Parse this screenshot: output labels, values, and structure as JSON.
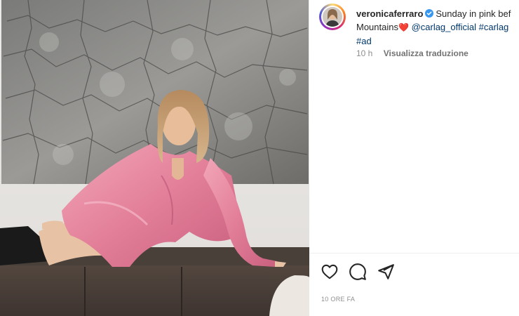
{
  "post": {
    "username": "veronicaferraro",
    "caption_line1": "Sunday in pink bef",
    "caption_line2_text": "Mountains",
    "heart_emoji": "❤️",
    "mention": "@carlag_official",
    "hashtag_1": "#carlag",
    "hashtag_2": "#ad",
    "time_ago_short": "10 h",
    "translate_label": "Visualizza traduzione",
    "time_ago_long": "10 ORE FA"
  },
  "icons": {
    "like": "heart-icon",
    "comment": "comment-icon",
    "share": "paper-plane-icon",
    "verified": "verified-badge-icon"
  },
  "colors": {
    "dress": "#e8879f",
    "link": "#00376b",
    "verified": "#3897f0",
    "muted": "#8e8e8e"
  }
}
